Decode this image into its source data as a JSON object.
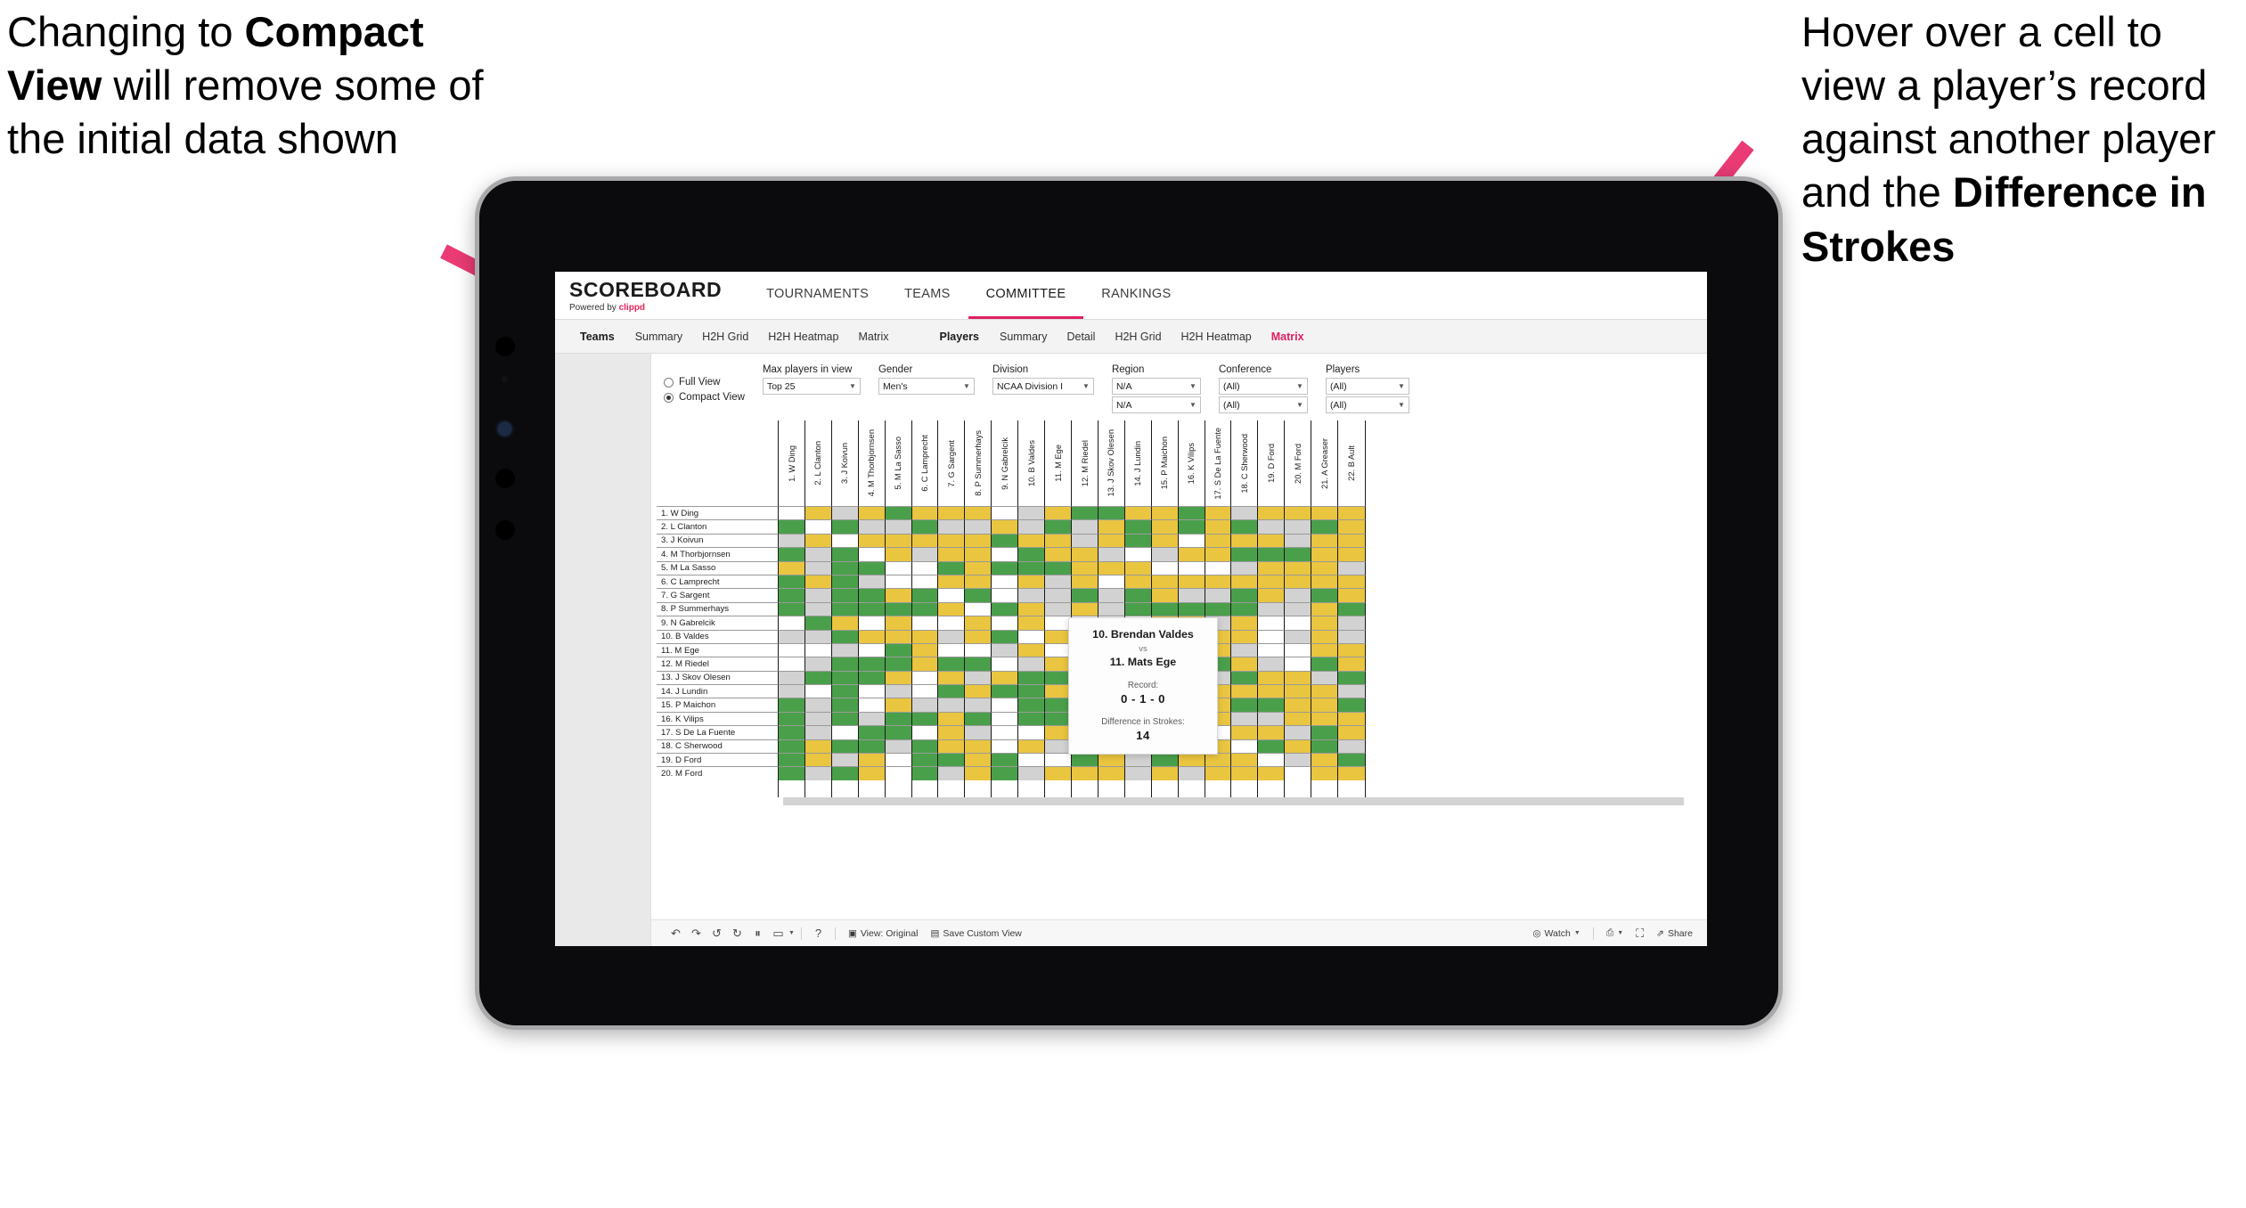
{
  "annotations": {
    "left": {
      "pre": "Changing to ",
      "bold": "Compact View",
      "post": " will remove some of the initial data shown"
    },
    "right": {
      "pre": "Hover over a cell to view a player’s record against another player and the ",
      "bold": "Difference in Strokes",
      "post": ""
    },
    "arrow_color": "#ea3b75"
  },
  "app": {
    "brand": {
      "title": "SCOREBOARD",
      "powered_prefix": "Powered by ",
      "powered_by": "clippd"
    },
    "topnav": [
      {
        "label": "TOURNAMENTS",
        "active": false
      },
      {
        "label": "TEAMS",
        "active": false
      },
      {
        "label": "COMMITTEE",
        "active": true
      },
      {
        "label": "RANKINGS",
        "active": false
      }
    ],
    "subnav": {
      "groups": [
        {
          "title": "Teams",
          "items": [
            {
              "label": "Summary",
              "active": false
            },
            {
              "label": "H2H Grid",
              "active": false
            },
            {
              "label": "H2H Heatmap",
              "active": false
            },
            {
              "label": "Matrix",
              "active": false
            }
          ]
        },
        {
          "title": "Players",
          "items": [
            {
              "label": "Summary",
              "active": false
            },
            {
              "label": "Detail",
              "active": false
            },
            {
              "label": "H2H Grid",
              "active": false
            },
            {
              "label": "H2H Heatmap",
              "active": false
            },
            {
              "label": "Matrix",
              "active": true
            }
          ]
        }
      ]
    }
  },
  "filters": {
    "view_options": [
      {
        "label": "Full View",
        "selected": false
      },
      {
        "label": "Compact View",
        "selected": true
      }
    ],
    "fields": [
      {
        "label": "Max players in view",
        "value": "Top 25",
        "value2": ""
      },
      {
        "label": "Gender",
        "value": "Men's",
        "value2": ""
      },
      {
        "label": "Division",
        "value": "NCAA Division I",
        "value2": ""
      },
      {
        "label": "Region",
        "value": "N/A",
        "value2": "N/A"
      },
      {
        "label": "Conference",
        "value": "(All)",
        "value2": "(All)"
      },
      {
        "label": "Players",
        "value": "(All)",
        "value2": "(All)"
      }
    ]
  },
  "matrix": {
    "row_labels": [
      "1. W Ding",
      "2. L Clanton",
      "3. J Koivun",
      "4. M Thorbjornsen",
      "5. M La Sasso",
      "6. C Lamprecht",
      "7. G Sargent",
      "8. P Summerhays",
      "9. N Gabrelcik",
      "10. B Valdes",
      "11. M Ege",
      "12. M Riedel",
      "13. J Skov Olesen",
      "14. J Lundin",
      "15. P Maichon",
      "16. K Vilips",
      "17. S De La Fuente",
      "18. C Sherwood",
      "19. D Ford",
      "20. M Ford"
    ],
    "col_labels": [
      "1. W Ding",
      "2. L Clanton",
      "3. J Koivun",
      "4. M Thorbjornsen",
      "5. M La Sasso",
      "6. C Lamprecht",
      "7. G Sargent",
      "8. P Summerhays",
      "9. N Gabrelcik",
      "10. B Valdes",
      "11. M Ege",
      "12. M Riedel",
      "13. J Skov Olesen",
      "14. J Lundin",
      "15. P Maichon",
      "16. K Vilips",
      "17. S De La Fuente",
      "18. C Sherwood",
      "19. D Ford",
      "20. M Ford",
      "21. A Greaser",
      "22. B Ault"
    ],
    "legend_colors": {
      "win": "#4aa04a",
      "tie": "#eac53f",
      "loss": "#d2d2d2",
      "self": "#ffffff"
    },
    "cells": [
      [
        "w",
        "y",
        "a",
        "y",
        "g",
        "y",
        "y",
        "y",
        "w",
        "a",
        "y",
        "g",
        "g",
        "y",
        "y",
        "g",
        "y",
        "a",
        "y",
        "y",
        "y",
        "y"
      ],
      [
        "g",
        "w",
        "g",
        "a",
        "a",
        "g",
        "a",
        "a",
        "y",
        "a",
        "g",
        "a",
        "y",
        "g",
        "y",
        "g",
        "y",
        "g",
        "a",
        "a",
        "g",
        "y"
      ],
      [
        "a",
        "y",
        "w",
        "y",
        "y",
        "y",
        "y",
        "y",
        "g",
        "y",
        "y",
        "a",
        "y",
        "g",
        "y",
        "w",
        "y",
        "y",
        "y",
        "a",
        "y",
        "y"
      ],
      [
        "g",
        "a",
        "g",
        "w",
        "y",
        "a",
        "y",
        "y",
        "w",
        "g",
        "y",
        "y",
        "a",
        "w",
        "a",
        "y",
        "y",
        "g",
        "g",
        "g",
        "y",
        "y"
      ],
      [
        "y",
        "a",
        "g",
        "g",
        "w",
        "w",
        "g",
        "y",
        "g",
        "g",
        "g",
        "y",
        "y",
        "y",
        "w",
        "w",
        "w",
        "a",
        "y",
        "y",
        "y",
        "a"
      ],
      [
        "g",
        "y",
        "g",
        "a",
        "w",
        "w",
        "y",
        "y",
        "w",
        "y",
        "a",
        "y",
        "w",
        "y",
        "y",
        "y",
        "y",
        "y",
        "y",
        "y",
        "y",
        "y"
      ],
      [
        "g",
        "a",
        "g",
        "g",
        "y",
        "g",
        "w",
        "g",
        "w",
        "a",
        "a",
        "g",
        "a",
        "g",
        "y",
        "a",
        "a",
        "g",
        "y",
        "a",
        "g",
        "y"
      ],
      [
        "g",
        "a",
        "g",
        "g",
        "g",
        "g",
        "y",
        "w",
        "g",
        "y",
        "a",
        "y",
        "a",
        "g",
        "g",
        "g",
        "g",
        "g",
        "a",
        "a",
        "y",
        "g"
      ],
      [
        "w",
        "g",
        "y",
        "w",
        "y",
        "w",
        "w",
        "y",
        "w",
        "y",
        "w",
        "w",
        "w",
        "w",
        "y",
        "y",
        "a",
        "y",
        "w",
        "w",
        "y",
        "a"
      ],
      [
        "a",
        "a",
        "g",
        "y",
        "y",
        "y",
        "a",
        "y",
        "g",
        "w",
        "y",
        "w",
        "w",
        "g",
        "g",
        "y",
        "y",
        "y",
        "w",
        "a",
        "y",
        "a"
      ],
      [
        "w",
        "w",
        "a",
        "w",
        "g",
        "y",
        "w",
        "w",
        "a",
        "y",
        "w",
        "w",
        "w",
        "w",
        "y",
        "y",
        "y",
        "a",
        "w",
        "w",
        "y",
        "y"
      ],
      [
        "w",
        "a",
        "g",
        "g",
        "g",
        "y",
        "g",
        "g",
        "w",
        "a",
        "y",
        "w",
        "g",
        "a",
        "a",
        "g",
        "g",
        "y",
        "a",
        "w",
        "g",
        "y"
      ],
      [
        "a",
        "g",
        "g",
        "g",
        "y",
        "w",
        "y",
        "a",
        "y",
        "g",
        "g",
        "g",
        "w",
        "y",
        "y",
        "y",
        "a",
        "g",
        "y",
        "y",
        "a",
        "g"
      ],
      [
        "a",
        "w",
        "g",
        "w",
        "a",
        "w",
        "g",
        "y",
        "g",
        "g",
        "y",
        "a",
        "y",
        "w",
        "g",
        "a",
        "y",
        "y",
        "y",
        "y",
        "y",
        "a"
      ],
      [
        "g",
        "a",
        "g",
        "w",
        "y",
        "a",
        "a",
        "a",
        "w",
        "g",
        "g",
        "g",
        "y",
        "a",
        "w",
        "a",
        "y",
        "g",
        "g",
        "y",
        "y",
        "g"
      ],
      [
        "g",
        "a",
        "g",
        "a",
        "g",
        "g",
        "y",
        "g",
        "w",
        "g",
        "g",
        "y",
        "g",
        "g",
        "g",
        "w",
        "y",
        "a",
        "a",
        "y",
        "y",
        "y"
      ],
      [
        "g",
        "a",
        "w",
        "g",
        "g",
        "w",
        "y",
        "a",
        "w",
        "w",
        "y",
        "g",
        "y",
        "y",
        "y",
        "y",
        "w",
        "y",
        "y",
        "a",
        "g",
        "y"
      ],
      [
        "g",
        "y",
        "g",
        "g",
        "a",
        "g",
        "y",
        "y",
        "w",
        "y",
        "a",
        "y",
        "g",
        "g",
        "y",
        "y",
        "y",
        "w",
        "g",
        "y",
        "g",
        "a"
      ],
      [
        "g",
        "y",
        "a",
        "y",
        "w",
        "g",
        "g",
        "y",
        "g",
        "w",
        "w",
        "g",
        "y",
        "a",
        "g",
        "y",
        "y",
        "y",
        "w",
        "a",
        "y",
        "g"
      ],
      [
        "g",
        "a",
        "g",
        "y",
        "w",
        "g",
        "a",
        "y",
        "g",
        "a",
        "y",
        "y",
        "y",
        "a",
        "y",
        "a",
        "y",
        "y",
        "y",
        "w",
        "y",
        "y"
      ]
    ]
  },
  "tooltip": {
    "player_a": "10. Brendan Valdes",
    "vs": "vs",
    "player_b": "11. Mats Ege",
    "record_label": "Record:",
    "record_value": "0 - 1 - 0",
    "strokes_label": "Difference in Strokes:",
    "strokes_value": "14"
  },
  "toolbar": {
    "icons": [
      {
        "name": "undo-icon",
        "glyph": "↶"
      },
      {
        "name": "redo-icon",
        "glyph": "↷"
      },
      {
        "name": "revert-icon",
        "glyph": "↺"
      },
      {
        "name": "refresh-data-icon",
        "glyph": "↻"
      },
      {
        "name": "pause-updates-icon",
        "glyph": "⏸"
      },
      {
        "name": "zoom-control-icon",
        "glyph": "▭"
      }
    ],
    "help_icon": "?",
    "view_original_label": "View: Original",
    "save_custom_view_label": "Save Custom View",
    "watch_label": "Watch",
    "download_icon": "⬇",
    "fullscreen_icon": "⛶",
    "share_label": "Share"
  }
}
